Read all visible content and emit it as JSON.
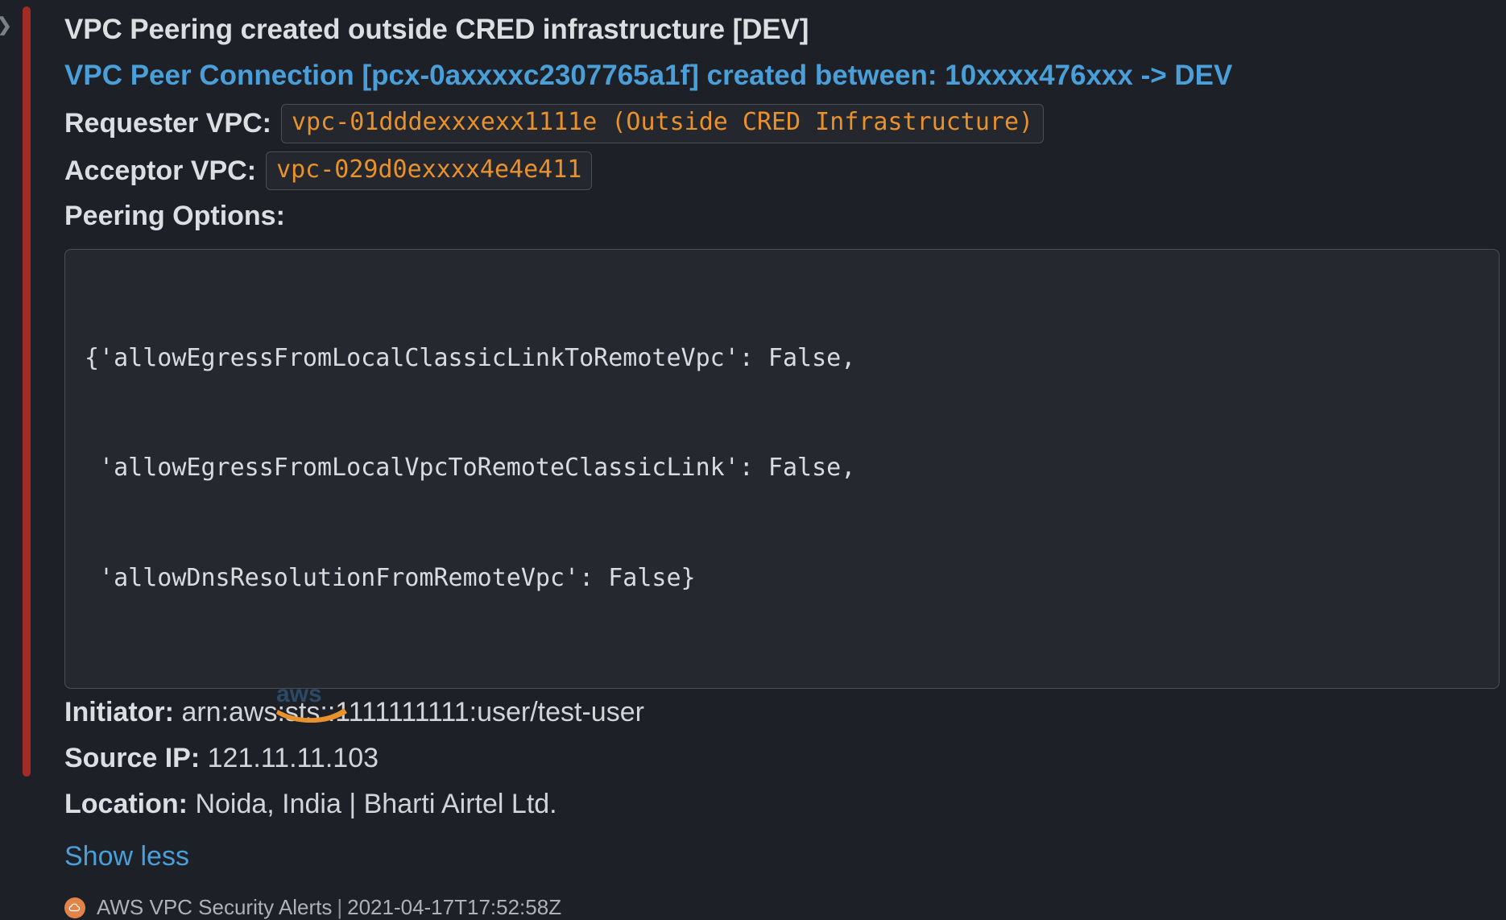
{
  "attachment": {
    "accent_color": "#a32b26",
    "title": "VPC Peering created outside CRED infrastructure [DEV]",
    "subtitle": "VPC Peer Connection [pcx-0axxxxc2307765a1f] created between: 10xxxx476xxx -> DEV",
    "fields": {
      "requester_vpc_label": "Requester VPC:",
      "requester_vpc_value": "vpc-01dddexxxexx1111e (Outside CRED Infrastructure)",
      "acceptor_vpc_label": "Acceptor VPC:",
      "acceptor_vpc_value": "vpc-029d0exxxx4e4e411",
      "peering_options_label": "Peering Options:"
    },
    "peering_options_code": [
      "{'allowEgressFromLocalClassicLinkToRemoteVpc': False,",
      " 'allowEgressFromLocalVpcToRemoteClassicLink': False,",
      " 'allowDnsResolutionFromRemoteVpc': False}"
    ],
    "meta": {
      "initiator_label": "Initiator:",
      "initiator_value": "arn:aws:sts::1111111111:user/test-user",
      "source_ip_label": "Source IP:",
      "source_ip_value": "121.11.11.103",
      "location_label": "Location:",
      "location_value": "Noida, India | Bharti Airtel Ltd."
    },
    "show_less_label": "Show less",
    "footer": {
      "app_name": "AWS VPC Security Alerts",
      "separator": "|",
      "timestamp": "2021-04-17T17:52:58Z",
      "app_icon": "cloud-icon",
      "app_icon_color": "#e2844a"
    }
  },
  "watermark": {
    "name": "aws-logo-watermark",
    "text": "aws"
  },
  "edge_glyph": "❯"
}
